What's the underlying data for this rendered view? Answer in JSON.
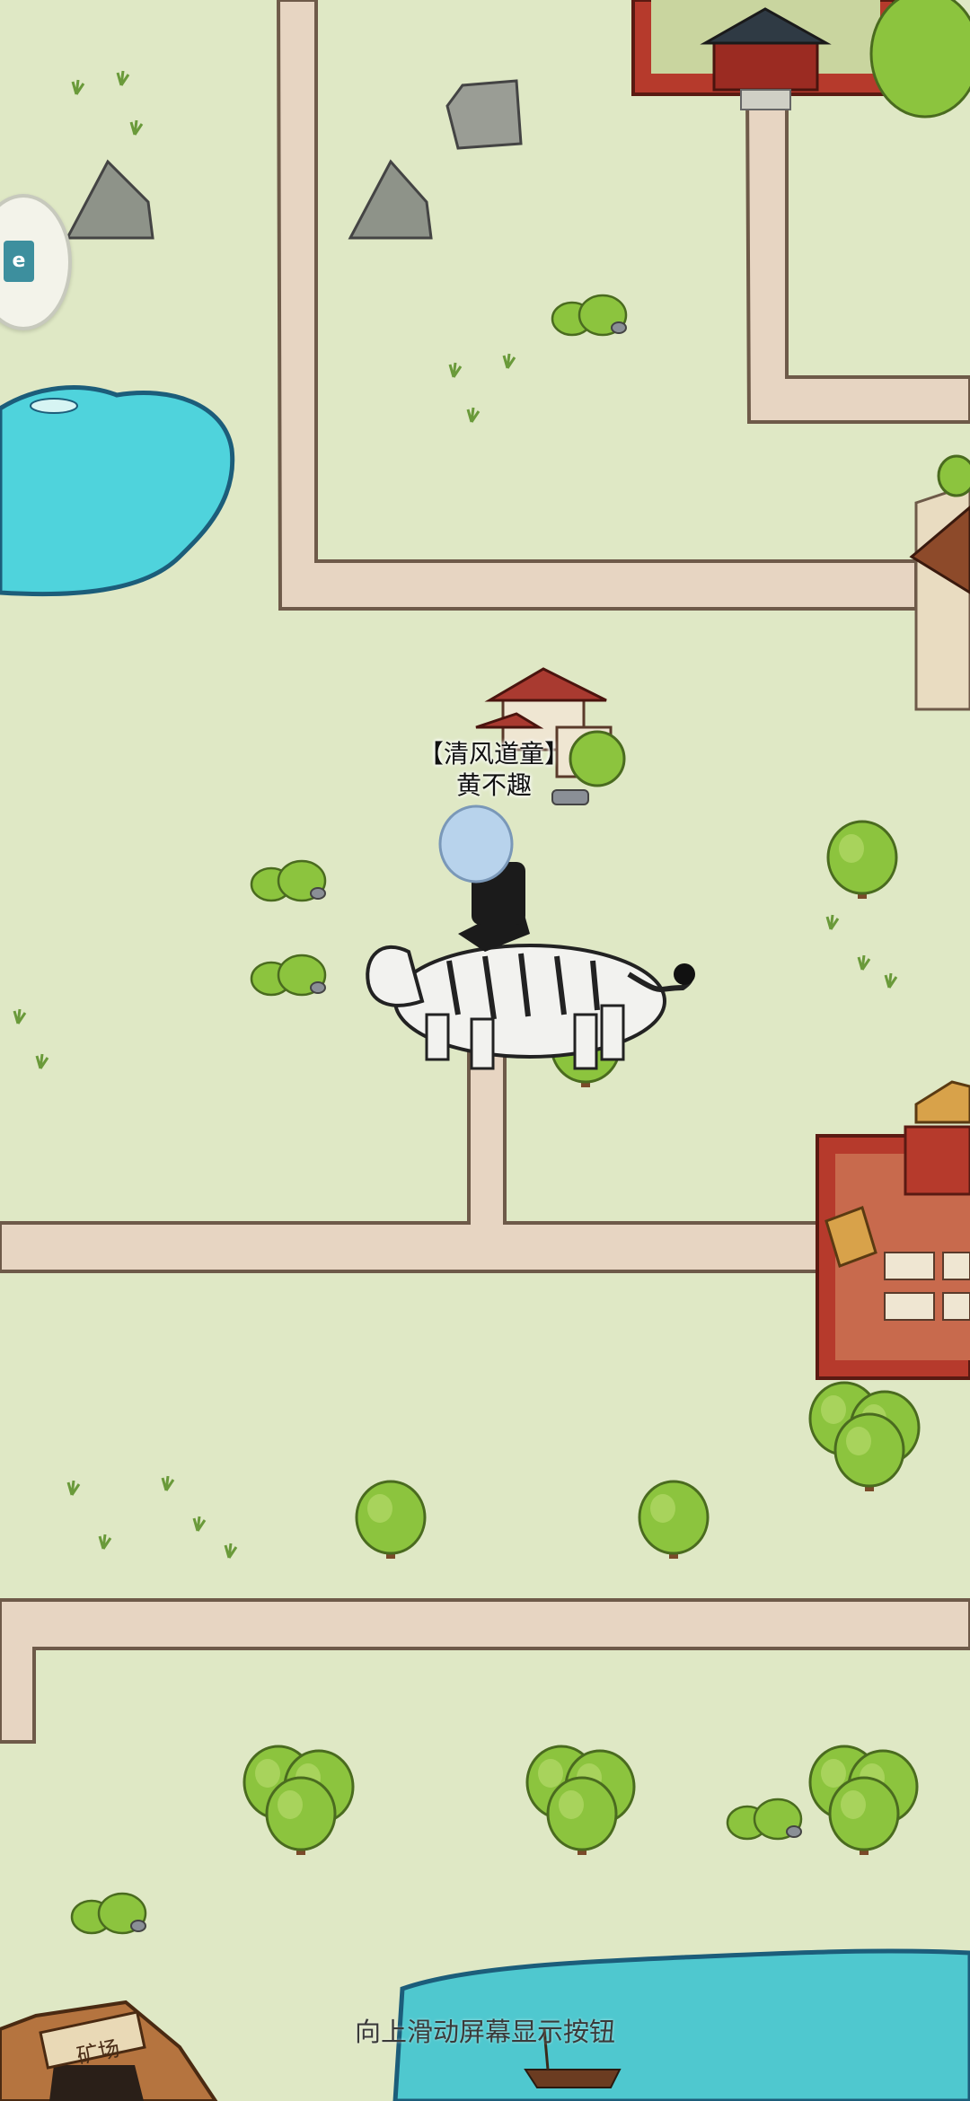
{
  "npc": {
    "title": "【清风道童】",
    "name": "黄不趣"
  },
  "hint_text": "向上滑动屏幕显示按钮",
  "mine_sign": "矿场",
  "side_button": {
    "icon": "map-menu-icon",
    "glyph": "e"
  },
  "colors": {
    "grass": "#dfe8c5",
    "road": "#e7d5c2",
    "road_edge": "#6e5a49",
    "water": "#4fd3dc",
    "wall_red": "#b63a2c",
    "tree": "#8cc43e"
  }
}
